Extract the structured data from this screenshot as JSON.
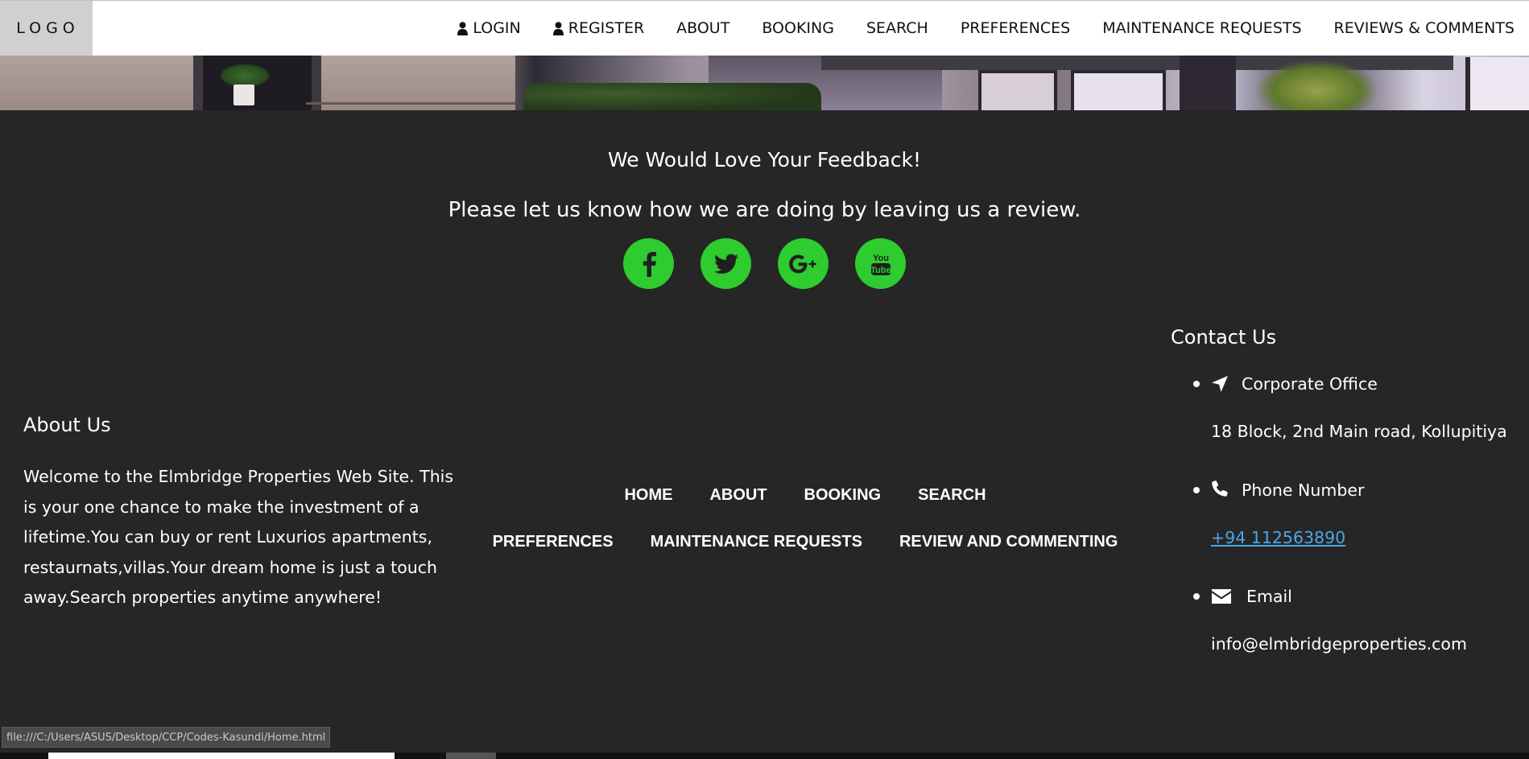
{
  "header": {
    "logo": "LOGO",
    "nav": [
      {
        "label": "LOGIN",
        "icon": "user-icon"
      },
      {
        "label": "REGISTER",
        "icon": "user-icon"
      },
      {
        "label": "ABOUT"
      },
      {
        "label": "BOOKING"
      },
      {
        "label": "SEARCH"
      },
      {
        "label": "PREFERENCES"
      },
      {
        "label": "MAINTENANCE REQUESTS"
      },
      {
        "label": "REVIEWS & COMMENTS"
      }
    ]
  },
  "feedback": {
    "title": "We Would Love Your Feedback!",
    "subtitle": "Please let us know how we are doing by leaving us a review.",
    "social": [
      {
        "name": "facebook-icon"
      },
      {
        "name": "twitter-icon"
      },
      {
        "name": "google-plus-icon"
      },
      {
        "name": "youtube-icon"
      }
    ],
    "accent_color": "#2ecc2e"
  },
  "about": {
    "title": "About Us",
    "text": "Welcome to the Elmbridge Properties Web Site. This is your one chance to make the investment of a lifetime.You can buy or rent Luxurios apartments, restaurnats,villas.Your dream home is just a touch away.Search properties anytime anywhere!"
  },
  "footer_nav": {
    "row1": [
      "HOME",
      "ABOUT",
      "BOOKING",
      "SEARCH"
    ],
    "row2": [
      "PREFERENCES",
      "MAINTENANCE REQUESTS",
      "REVIEW AND COMMENTING"
    ]
  },
  "contact": {
    "title": "Contact Us",
    "office_label": "Corporate Office",
    "office_value": "18 Block, 2nd Main road, Kollupitiya",
    "phone_label": "Phone Number",
    "phone_value": "+94 112563890",
    "email_label": "Email",
    "email_value": "info@elmbridgeproperties.com",
    "link_color": "#4aa6e8"
  },
  "status_bar": {
    "url": "file:///C:/Users/ASUS/Desktop/CCP/Codes-Kasundi/Home.html"
  }
}
